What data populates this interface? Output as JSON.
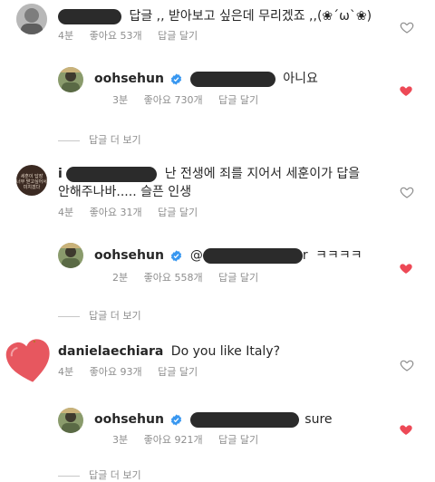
{
  "comments": [
    {
      "username_redacted": true,
      "text": "답글 ,, 받아보고 싶은데 무리겠죠 ,,(❀´ω`❀)",
      "time": "4분",
      "likes": "좋아요 53개",
      "reply": "답글 달기",
      "liked": false
    },
    {
      "username": "oohsehun",
      "text": "아니요",
      "time": "3분",
      "likes": "좋아요 730개",
      "reply": "답글 달기",
      "liked": true
    },
    {
      "more_replies": "답글 더 보기"
    },
    {
      "username_prefix": "i",
      "text_line1": "난 전생에 죄를 지어서 세훈이가 답을",
      "text_line2": "안해주나바..... 슬픈 인생",
      "avatar_caption": "세훈이 답장 너무 받고싶어서 미치겠다",
      "time": "4분",
      "likes": "좋아요 31개",
      "reply": "답글 달기",
      "liked": false
    },
    {
      "username": "oohsehun",
      "mention_at": "@",
      "mention_tail": "r",
      "text": "ㅋㅋㅋㅋ",
      "time": "2분",
      "likes": "좋아요 558개",
      "reply": "답글 달기",
      "liked": true
    },
    {
      "more_replies": "답글 더 보기"
    },
    {
      "username": "danielaechiara",
      "text": "Do you like Italy?",
      "time": "4분",
      "likes": "좋아요 93개",
      "reply": "답글 달기",
      "liked": false
    },
    {
      "username": "oohsehun",
      "text": "sure",
      "time": "3분",
      "likes": "좋아요 921개",
      "reply": "답글 달기",
      "liked": true
    },
    {
      "more_replies": "답글 더 보기"
    }
  ],
  "colors": {
    "heart_liked": "#ed4956",
    "heart_outline": "#8e8e8e",
    "verified": "#3897f0",
    "meta": "#8e8e8e"
  },
  "icons": [
    "verified-badge-icon",
    "heart-icon",
    "heart-outline-icon"
  ]
}
